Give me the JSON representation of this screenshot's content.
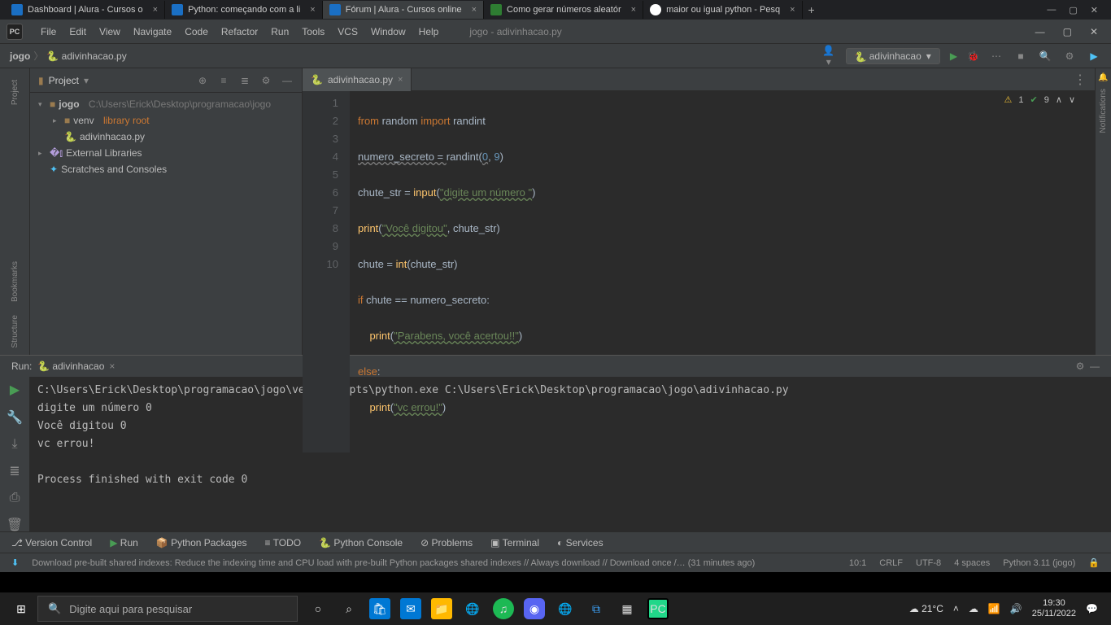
{
  "browser": {
    "tabs": [
      {
        "title": "Dashboard | Alura - Cursos o"
      },
      {
        "title": "Python: começando com a li"
      },
      {
        "title": "Fórum | Alura - Cursos online"
      },
      {
        "title": "Como gerar números aleatór"
      },
      {
        "title": "maior ou igual python - Pesq"
      }
    ]
  },
  "ide": {
    "title_file": "jogo - adivinhacao.py",
    "menu": [
      "File",
      "Edit",
      "View",
      "Navigate",
      "Code",
      "Refactor",
      "Run",
      "Tools",
      "VCS",
      "Window",
      "Help"
    ],
    "breadcrumbs": [
      "jogo",
      "adivinhacao.py"
    ],
    "run_config": "adivinhacao",
    "project_panel": {
      "title": "Project",
      "root": "jogo",
      "root_path": "C:\\Users\\Erick\\Desktop\\programacao\\jogo",
      "venv": "venv",
      "venv_hint": "library root",
      "file": "adivinhacao.py",
      "ext_lib": "External Libraries",
      "scratch": "Scratches and Consoles"
    },
    "editor": {
      "tab": "adivinhacao.py",
      "indicators": {
        "warn_count": "1",
        "ok_count": "9"
      },
      "lines": [
        "1",
        "2",
        "3",
        "4",
        "5",
        "6",
        "7",
        "8",
        "9",
        "10"
      ],
      "code": {
        "l1": {
          "a": "from",
          "b": "random",
          "c": "import",
          "d": "randint"
        },
        "l2": {
          "a": "numero_secreto = ",
          "b": "randint",
          "c": "(",
          "d": "0",
          "e": ", ",
          "f": "9",
          "g": ")"
        },
        "l3": {
          "a": "chute_str = ",
          "b": "input",
          "c": "(",
          "d": "\"digite um número \"",
          "e": ")"
        },
        "l4": {
          "a": "print",
          "b": "(",
          "c": "\"Você digitou\"",
          "d": ", chute_str)"
        },
        "l5": {
          "a": "chute = ",
          "b": "int",
          "c": "(chute_str)"
        },
        "l6": {
          "a": "if",
          "b": " chute == numero_secreto:"
        },
        "l7": {
          "a": "    ",
          "b": "print",
          "c": "(",
          "d": "\"Parabens, você acertou!!\"",
          "e": ")"
        },
        "l8": {
          "a": "else",
          "b": ":"
        },
        "l9": {
          "a": "    ",
          "b": "print",
          "c": "(",
          "d": "\"vc errou!\"",
          "e": ")"
        }
      }
    },
    "run_panel": {
      "title": "Run:",
      "config": "adivinhacao",
      "output": "C:\\Users\\Erick\\Desktop\\programacao\\jogo\\venv\\Scripts\\python.exe C:\\Users\\Erick\\Desktop\\programacao\\jogo\\adivinhacao.py\ndigite um número 0\nVocê digitou 0\nvc errou!\n\nProcess finished with exit code 0"
    },
    "toolstrip": [
      "Version Control",
      "Run",
      "Python Packages",
      "TODO",
      "Python Console",
      "Problems",
      "Terminal",
      "Services"
    ],
    "statusbar": {
      "msg": "Download pre-built shared indexes: Reduce the indexing time and CPU load with pre-built Python packages shared indexes // Always download // Download once /… (31 minutes ago)",
      "pos": "10:1",
      "enc": "CRLF",
      "charset": "UTF-8",
      "indent": "4 spaces",
      "interp": "Python 3.11 (jogo)"
    },
    "side_left": [
      "Project",
      "Bookmarks",
      "Structure"
    ],
    "side_right": "Notifications"
  },
  "taskbar": {
    "search_placeholder": "Digite aqui para pesquisar",
    "weather": "21°C",
    "time": "19:30",
    "date": "25/11/2022"
  }
}
